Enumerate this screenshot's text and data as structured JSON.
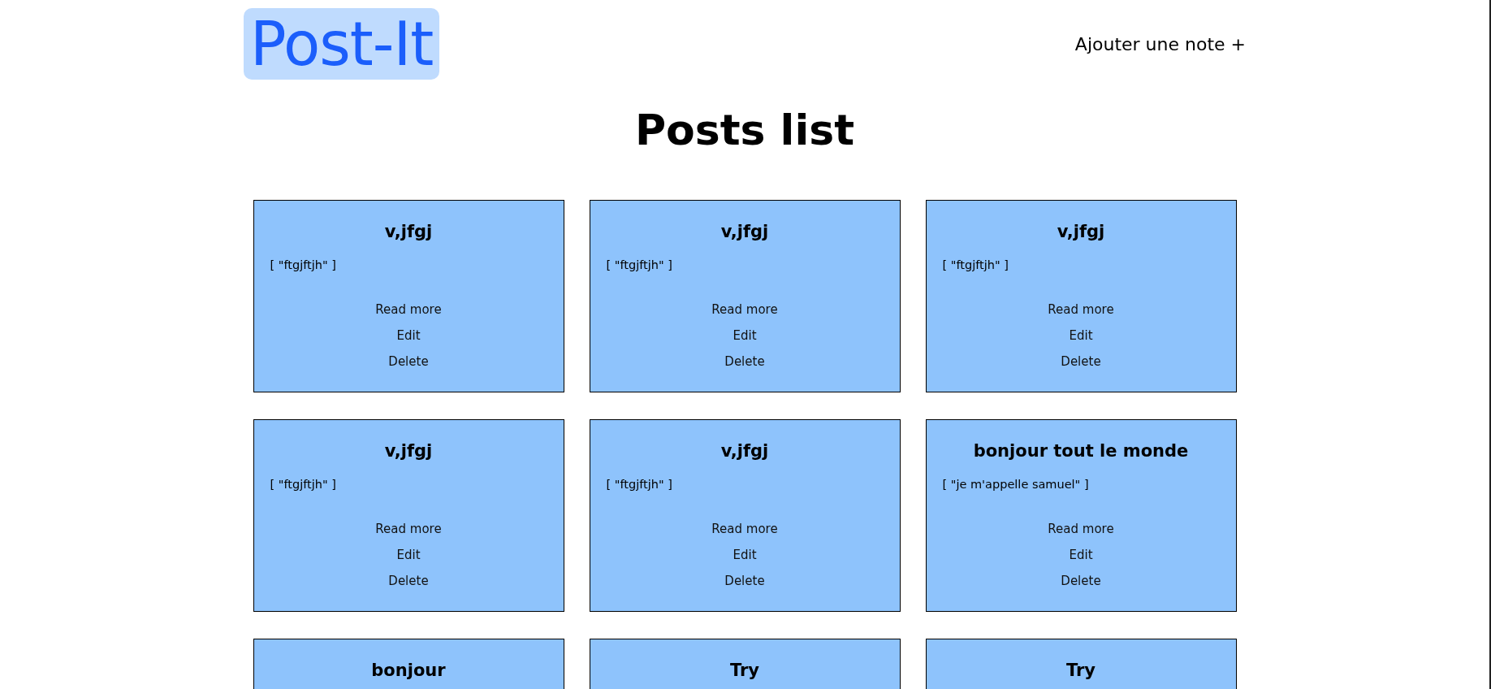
{
  "header": {
    "logo": "Post-It",
    "add_link": "Ajouter une note +"
  },
  "page_title": "Posts list",
  "posts": [
    {
      "title": "v,jfgj",
      "body": "[ \"ftgjftjh\" ]",
      "actions": [
        "Read more",
        "Edit",
        "Delete"
      ]
    },
    {
      "title": "v,jfgj",
      "body": "[ \"ftgjftjh\" ]",
      "actions": [
        "Read more",
        "Edit",
        "Delete"
      ]
    },
    {
      "title": "v,jfgj",
      "body": "[ \"ftgjftjh\" ]",
      "actions": [
        "Read more",
        "Edit",
        "Delete"
      ]
    },
    {
      "title": "v,jfgj",
      "body": "[ \"ftgjftjh\" ]",
      "actions": [
        "Read more",
        "Edit",
        "Delete"
      ]
    },
    {
      "title": "v,jfgj",
      "body": "[ \"ftgjftjh\" ]",
      "actions": [
        "Read more",
        "Edit",
        "Delete"
      ]
    },
    {
      "title": "bonjour tout le monde",
      "body": "[ \"je m'appelle samuel\" ]",
      "actions": [
        "Read more",
        "Edit",
        "Delete"
      ]
    },
    {
      "title": "bonjour"
    },
    {
      "title": "Try"
    },
    {
      "title": "Try"
    }
  ]
}
